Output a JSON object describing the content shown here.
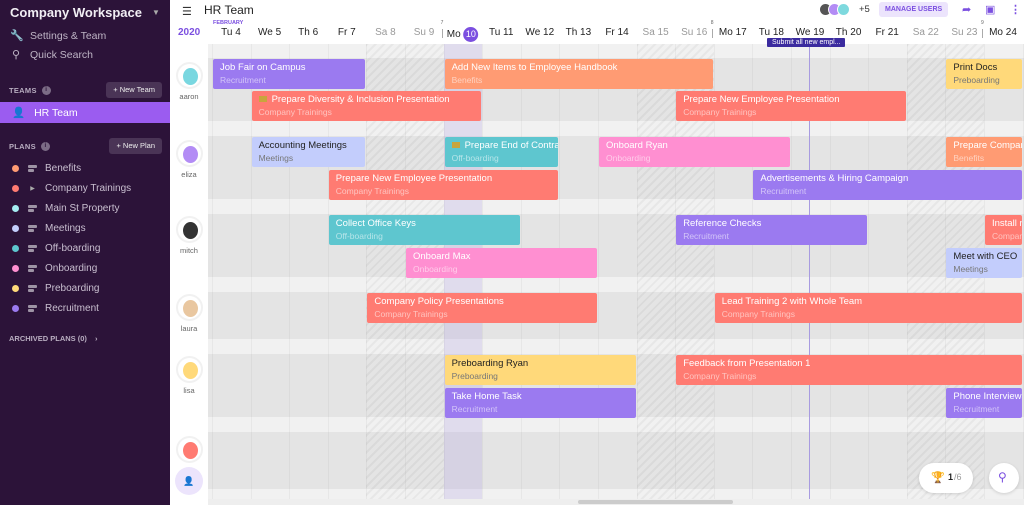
{
  "sidebar": {
    "workspace": "Company Workspace",
    "links": [
      {
        "label": "Settings & Team",
        "icon": "wrench-icon"
      },
      {
        "label": "Quick Search",
        "icon": "search-icon"
      }
    ],
    "teams_label": "TEAMS",
    "new_team": "+ New Team",
    "active_team": "HR Team",
    "plans_label": "PLANS",
    "new_plan": "+ New Plan",
    "plans": [
      {
        "label": "Benefits",
        "color": "#ff9b73"
      },
      {
        "label": "Company Trainings",
        "color": "#ff7b72"
      },
      {
        "label": "Main St Property",
        "color": "#a5ecf2"
      },
      {
        "label": "Meetings",
        "color": "#c3cdfc"
      },
      {
        "label": "Off-boarding",
        "color": "#5ec6cf"
      },
      {
        "label": "Onboarding",
        "color": "#ff8fd1"
      },
      {
        "label": "Preboarding",
        "color": "#ffd97a"
      },
      {
        "label": "Recruitment",
        "color": "#9b7af0"
      }
    ],
    "archived": "ARCHIVED PLANS (0)"
  },
  "topbar": {
    "title": "HR Team",
    "extra_users": "+5",
    "manage_users": "MANAGE USERS"
  },
  "timeline": {
    "year": "2020",
    "month": "FEBRUARY",
    "days": [
      "Tu 4",
      "We 5",
      "Th 6",
      "Fr 7",
      "Sa 8",
      "Su 9",
      "Mo",
      "Tu 11",
      "We 12",
      "Th 13",
      "Fr 14",
      "Sa 15",
      "Su 16",
      "Mo 17",
      "Tu 18",
      "We 19",
      "Th 20",
      "Fr 21",
      "Sa 22",
      "Su 23",
      "Mo 24"
    ],
    "today_num": "10",
    "week_numbers": [
      "7",
      "8",
      "9"
    ],
    "tooltip": "Submit all new empl..."
  },
  "people": [
    "aaron",
    "eliza",
    "mitch",
    "laura",
    "lisa",
    ""
  ],
  "tasks": [
    {
      "title": "Job Fair on Campus",
      "plan": "Recruitment",
      "color": "#9b7af0"
    },
    {
      "title": "Add New Items to Employee Handbook",
      "plan": "Benefits",
      "color": "#ff9b73"
    },
    {
      "title": "Print Docs",
      "plan": "Preboarding",
      "color": "#ffd97a"
    },
    {
      "title": "Prepare Diversity & Inclusion Presentation",
      "plan": "Company Trainings",
      "color": "#ff7b72"
    },
    {
      "title": "Prepare New Employee Presentation",
      "plan": "Company Trainings",
      "color": "#ff7b72"
    },
    {
      "title": "Accounting Meetings",
      "plan": "Meetings",
      "color": "#c3cdfc"
    },
    {
      "title": "Prepare End of Contra",
      "plan": "Off-boarding",
      "color": "#5ec6cf"
    },
    {
      "title": "Onboard Ryan",
      "plan": "Onboarding",
      "color": "#ff8fd1"
    },
    {
      "title": "Prepare Company",
      "plan": "Benefits",
      "color": "#ff9b73"
    },
    {
      "title": "Prepare New Employee Presentation",
      "plan": "Company Trainings",
      "color": "#ff7b72"
    },
    {
      "title": "Advertisements & Hiring Campaign",
      "plan": "Recruitment",
      "color": "#9b7af0"
    },
    {
      "title": "Collect Office Keys",
      "plan": "Off-boarding",
      "color": "#5ec6cf"
    },
    {
      "title": "Reference Checks",
      "plan": "Recruitment",
      "color": "#9b7af0"
    },
    {
      "title": "Install ne",
      "plan": "Compan",
      "color": "#ff7b72"
    },
    {
      "title": "Onboard Max",
      "plan": "Onboarding",
      "color": "#ff8fd1"
    },
    {
      "title": "Meet with CEO",
      "plan": "Meetings",
      "color": "#c3cdfc"
    },
    {
      "title": "Company Policy Presentations",
      "plan": "Company Trainings",
      "color": "#ff7b72"
    },
    {
      "title": "Lead Training 2 with Whole Team",
      "plan": "Company Trainings",
      "color": "#ff7b72"
    },
    {
      "title": "Preboarding Ryan",
      "plan": "Preboarding",
      "color": "#ffd97a"
    },
    {
      "title": "Feedback from Presentation 1",
      "plan": "Company Trainings",
      "color": "#ff7b72"
    },
    {
      "title": "Take Home Task",
      "plan": "Recruitment",
      "color": "#9b7af0"
    },
    {
      "title": "Phone Interviews",
      "plan": "Recruitment",
      "color": "#9b7af0"
    }
  ],
  "achievements": {
    "current": "1",
    "total": "/6"
  }
}
